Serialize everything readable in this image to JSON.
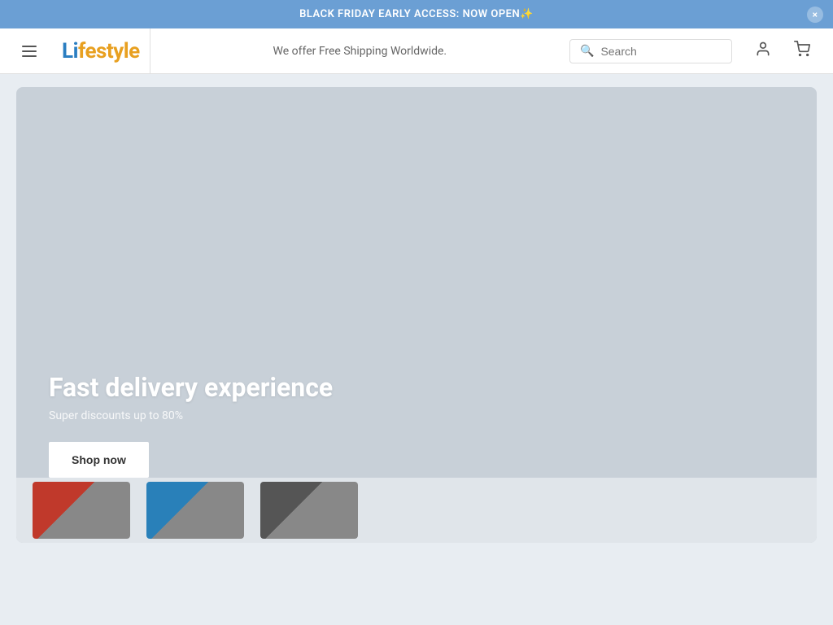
{
  "banner": {
    "text": "BLACK FRIDAY EARLY ACCESS: NOW OPEN✨",
    "close_icon": "×"
  },
  "header": {
    "menu_icon": "menu-icon",
    "logo": {
      "part1": "Li",
      "part2": "festyle"
    },
    "shipping_text": "We offer Free Shipping Worldwide.",
    "search_placeholder": "Search",
    "user_icon": "👤",
    "cart_icon": "🛒"
  },
  "hero": {
    "title": "Fast delivery experience",
    "subtitle": "Super discounts up to 80%",
    "cta_label": "Shop now",
    "bg_color": "#c8d0d8"
  },
  "products": [
    {
      "color": "red",
      "label": "product-1"
    },
    {
      "color": "blue",
      "label": "product-2"
    },
    {
      "color": "dark",
      "label": "product-3"
    }
  ]
}
